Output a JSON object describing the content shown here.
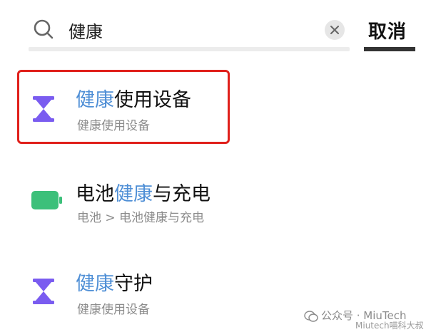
{
  "search": {
    "query": "健康",
    "cancel_label": "取消"
  },
  "results": [
    {
      "title_highlight": "健康",
      "title_rest": "使用设备",
      "subtitle": "健康使用设备",
      "icon": "hourglass-icon",
      "icon_color": "#7a5cf0"
    },
    {
      "title_prefix": "电池",
      "title_highlight": "健康",
      "title_rest": "与充电",
      "subtitle": "电池 > 电池健康与充电",
      "icon": "battery-icon",
      "icon_color": "#3cc07a"
    },
    {
      "title_highlight": "健康",
      "title_rest": "守护",
      "subtitle": "健康使用设备",
      "icon": "hourglass-icon",
      "icon_color": "#7a5cf0"
    }
  ],
  "watermark": {
    "line1": "公众号 · MiuTech",
    "line2": "Miutech喵科大叔"
  },
  "colors": {
    "highlight_text": "#4f8fd6",
    "selection_border": "#e0201b"
  }
}
